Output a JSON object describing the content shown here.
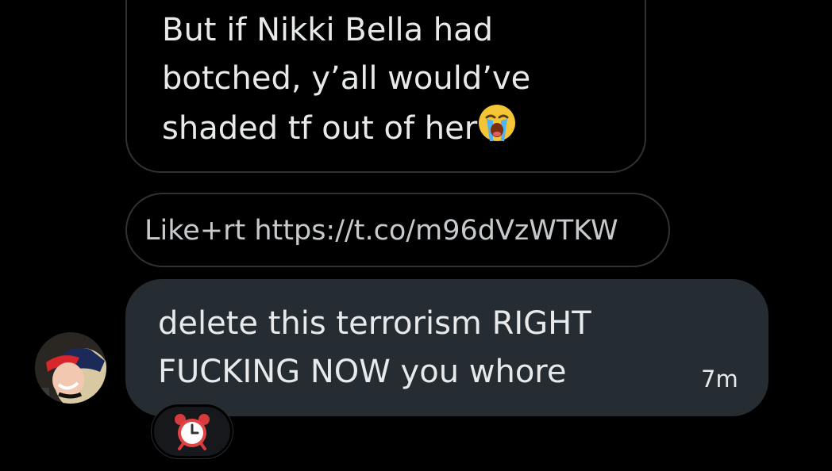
{
  "conversation": {
    "quoted_message": {
      "text_lines": [
        "But if Nikki Bella had",
        "botched, y’all would’ve",
        "shaded tf out of her"
      ],
      "emoji_icon": "loudly-crying-face-icon"
    },
    "link_message": {
      "text": "Like+rt https://t.co/m96dVzWTKW"
    },
    "incoming_message": {
      "text_lines": [
        "delete this terrorism RIGHT",
        "FUCKING NOW you whore"
      ],
      "timestamp": "7m",
      "avatar_icon": "user-avatar-icon",
      "reaction_icon": "alarm-clock-icon"
    }
  },
  "colors": {
    "background": "#000000",
    "bubble_incoming": "#252d33",
    "border": "#2f3336",
    "text_primary": "#e7e9ea",
    "text_link": "#c7cacc"
  }
}
